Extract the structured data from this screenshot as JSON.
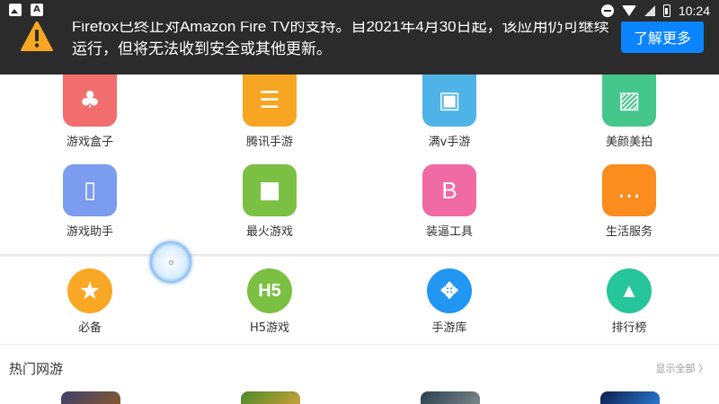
{
  "status_bar": {
    "time": "10:24",
    "left_icons": [
      "image-icon",
      "a-app-icon"
    ],
    "right_icons": [
      "dnd-icon",
      "wifi-icon",
      "signal-icon",
      "battery-icon"
    ]
  },
  "notice": {
    "icon": "warning-icon",
    "text": "Firefox已终止对Amazon Fire TV的支持。自2021年4月30日起，该应用仍可继续运行，但将无法收到安全或其他更新。",
    "button_label": "了解更多",
    "button_color": "#0a84ff"
  },
  "grid": [
    {
      "label": "游戏盒子",
      "color": "#f26d6d",
      "icon": "club-icon",
      "glyph": "♣"
    },
    {
      "label": "腾讯手游",
      "color": "#f6a623",
      "icon": "sliders-icon",
      "glyph": "☰"
    },
    {
      "label": "满v手游",
      "color": "#4fb3e8",
      "icon": "tv-icon",
      "glyph": "▣"
    },
    {
      "label": "美颜美拍",
      "color": "#45c68a",
      "icon": "image-icon",
      "glyph": "▨"
    },
    {
      "label": "游戏助手",
      "color": "#7c9cf0",
      "icon": "tablet-icon",
      "glyph": "▯"
    },
    {
      "label": "最火游戏",
      "color": "#7bc043",
      "icon": "video-camera-icon",
      "glyph": "■"
    },
    {
      "label": "装逼工具",
      "color": "#f06aa3",
      "icon": "letter-b-icon",
      "glyph": "B"
    },
    {
      "label": "生活服务",
      "color": "#fb8c1e",
      "icon": "chat-icon",
      "glyph": "…"
    }
  ],
  "nav": [
    {
      "label": "必备",
      "color": "#f9a825",
      "icon": "star-icon",
      "glyph": "★"
    },
    {
      "label": "H5游戏",
      "color": "#7bc043",
      "icon": "h5-icon",
      "glyph": "H5"
    },
    {
      "label": "手游库",
      "color": "#2196f3",
      "icon": "gamepad-icon",
      "glyph": "✥"
    },
    {
      "label": "排行榜",
      "color": "#26c59a",
      "icon": "android-icon",
      "glyph": "▲"
    }
  ],
  "hot_section": {
    "title": "热门网游",
    "show_all": "显示全部 〉"
  }
}
